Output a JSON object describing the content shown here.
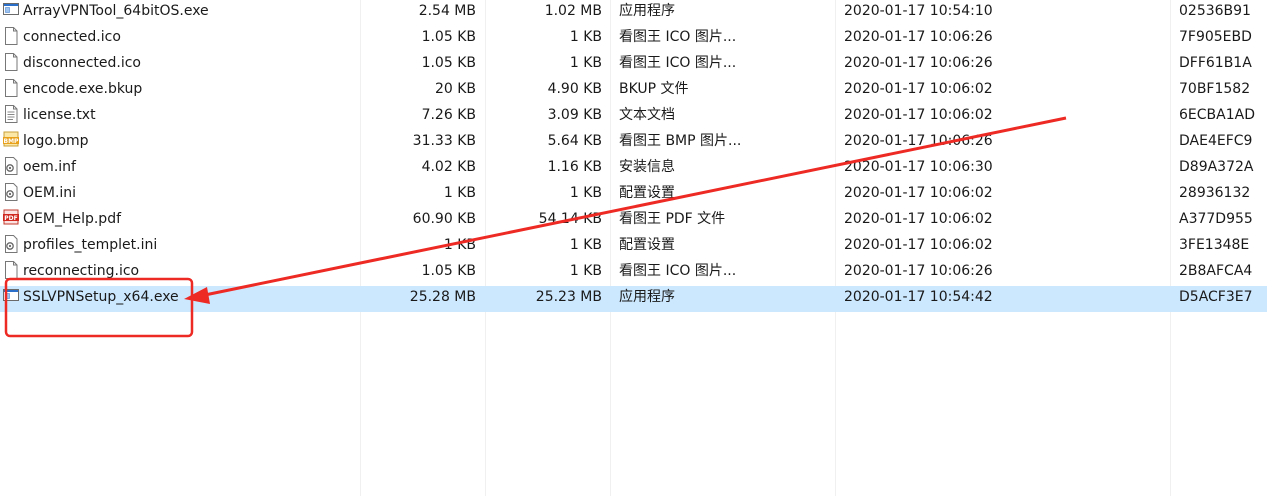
{
  "files": [
    {
      "name": "ArrayVPNTool_64bitOS.exe",
      "icon": "exe-window-icon",
      "size": "2.54 MB",
      "packed": "1.02 MB",
      "type": "应用程序",
      "modified": "2020-01-17 10:54:10",
      "crc": "02536B91"
    },
    {
      "name": "connected.ico",
      "icon": "blank-file-icon",
      "size": "1.05 KB",
      "packed": "1 KB",
      "type": "看图王 ICO 图片...",
      "modified": "2020-01-17 10:06:26",
      "crc": "7F905EBD"
    },
    {
      "name": "disconnected.ico",
      "icon": "blank-file-icon",
      "size": "1.05 KB",
      "packed": "1 KB",
      "type": "看图王 ICO 图片...",
      "modified": "2020-01-17 10:06:26",
      "crc": "DFF61B1A"
    },
    {
      "name": "encode.exe.bkup",
      "icon": "blank-file-icon",
      "size": "20 KB",
      "packed": "4.90 KB",
      "type": "BKUP 文件",
      "modified": "2020-01-17 10:06:02",
      "crc": "70BF1582"
    },
    {
      "name": "license.txt",
      "icon": "text-file-icon",
      "size": "7.26 KB",
      "packed": "3.09 KB",
      "type": "文本文档",
      "modified": "2020-01-17 10:06:02",
      "crc": "6ECBA1AD"
    },
    {
      "name": "logo.bmp",
      "icon": "bmp-file-icon",
      "size": "31.33 KB",
      "packed": "5.64 KB",
      "type": "看图王 BMP 图片...",
      "modified": "2020-01-17 10:06:26",
      "crc": "DAE4EFC9"
    },
    {
      "name": "oem.inf",
      "icon": "settings-file-icon",
      "size": "4.02 KB",
      "packed": "1.16 KB",
      "type": "安装信息",
      "modified": "2020-01-17 10:06:30",
      "crc": "D89A372A"
    },
    {
      "name": "OEM.ini",
      "icon": "settings-file-icon",
      "size": "1 KB",
      "packed": "1 KB",
      "type": "配置设置",
      "modified": "2020-01-17 10:06:02",
      "crc": "28936132"
    },
    {
      "name": "OEM_Help.pdf",
      "icon": "pdf-file-icon",
      "size": "60.90 KB",
      "packed": "54.14 KB",
      "type": "看图王 PDF 文件",
      "modified": "2020-01-17 10:06:02",
      "crc": "A377D955"
    },
    {
      "name": "profiles_templet.ini",
      "icon": "settings-file-icon",
      "size": "1 KB",
      "packed": "1 KB",
      "type": "配置设置",
      "modified": "2020-01-17 10:06:02",
      "crc": "3FE1348E"
    },
    {
      "name": "reconnecting.ico",
      "icon": "blank-file-icon",
      "size": "1.05 KB",
      "packed": "1 KB",
      "type": "看图王 ICO 图片...",
      "modified": "2020-01-17 10:06:26",
      "crc": "2B8AFCA4"
    },
    {
      "name": "SSLVPNSetup_x64.exe",
      "icon": "exe-window-icon",
      "size": "25.28 MB",
      "packed": "25.23 MB",
      "type": "应用程序",
      "modified": "2020-01-17 10:54:42",
      "crc": "D5ACF3E7",
      "selected": true
    }
  ],
  "annotation": {
    "color": "#ee2a24",
    "target": "SSLVPNSetup_x64.exe"
  },
  "colors": {
    "selection": "#cce8ff",
    "separator": "#f0f0f0"
  }
}
